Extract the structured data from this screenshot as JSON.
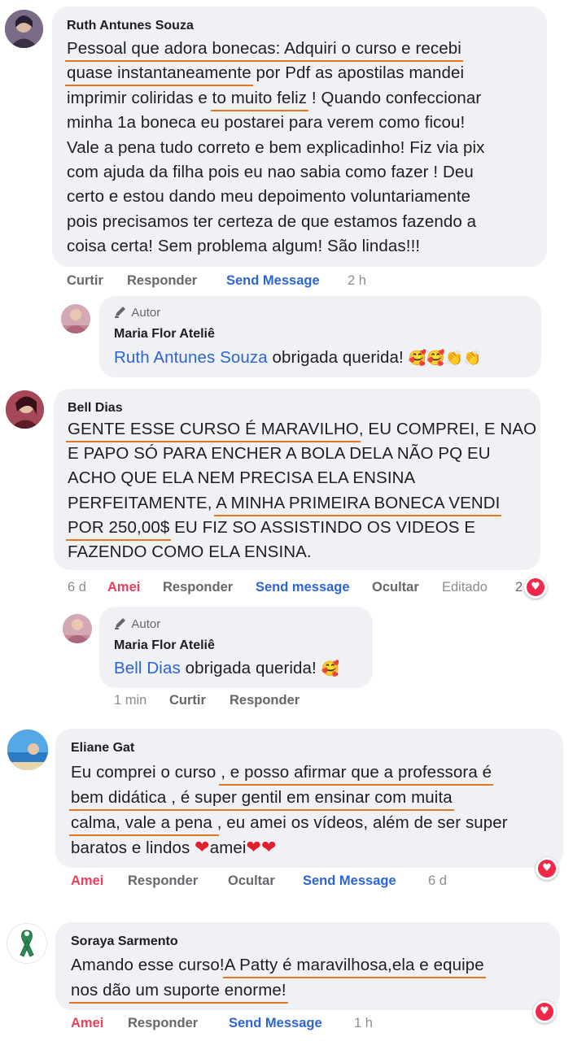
{
  "comments": [
    {
      "author": "Ruth Antunes Souza",
      "lines": [
        [
          {
            "t": "Pessoal que adora bonecas: Adquiri o curso e recebi",
            "u": true
          }
        ],
        [
          {
            "t": "quase instantaneamente",
            "u": true
          },
          {
            "t": " por Pdf as apostilas mandei"
          }
        ],
        [
          {
            "t": "imprimir coliridas e "
          },
          {
            "t": "to muito feliz",
            "u": true
          },
          {
            "t": " ! Quando confeccionar"
          }
        ],
        [
          {
            "t": "minha 1a boneca eu postarei para verem como ficou!"
          }
        ],
        [
          {
            "t": "Vale a pena tudo correto e bem explicadinho! Fiz via pix"
          }
        ],
        [
          {
            "t": "com ajuda da filha pois eu nao sabia como fazer ! Deu"
          }
        ],
        [
          {
            "t": "certo e estou dando meu depoimento voluntariamente"
          }
        ],
        [
          {
            "t": "pois precisamos ter certeza de que estamos fazendo a"
          }
        ],
        [
          {
            "t": "coisa certa! Sem problema algum! São lindas!!!"
          }
        ]
      ],
      "actions": {
        "like": "Curtir",
        "reply": "Responder",
        "send": "Send Message",
        "time": "2 h"
      },
      "reply": {
        "badge": "Autor",
        "author": "Maria Flor Ateliê",
        "mention": "Ruth Antunes Souza",
        "text": " obrigada querida! ",
        "emojis": "🥰🥰👏👏"
      }
    },
    {
      "author": "Bell Dias",
      "lines": [
        [
          {
            "t": "GENTE ESSE CURSO É MARAVILHO",
            "u": true
          },
          {
            "t": ", EU COMPREI, E NAO"
          }
        ],
        [
          {
            "t": "E PAPO SÓ PARA ENCHER A BOLA DELA NÃO PQ EU"
          }
        ],
        [
          {
            "t": "ACHO QUE ELA NEM PRECISA ELA ENSINA"
          }
        ],
        [
          {
            "t": "PERFEITAMENTE, "
          },
          {
            "t": "A MINHA PRIMEIRA BONECA VENDI",
            "u": true
          }
        ],
        [
          {
            "t": "POR 250,00$",
            "u": true
          },
          {
            "t": " EU FIZ SO ASSISTINDO OS VIDEOS E"
          }
        ],
        [
          {
            "t": "FAZENDO COMO ELA ENSINA."
          }
        ]
      ],
      "actions": {
        "time": "6 d",
        "like": "Amei",
        "reply": "Responder",
        "send": "Send message",
        "hide": "Ocultar",
        "edited": "Editado",
        "count": "2"
      },
      "reply": {
        "badge": "Autor",
        "author": "Maria Flor Ateliê",
        "mention": "Bell Dias",
        "text": " obrigada querida! ",
        "emojis": "🥰",
        "actions": {
          "time": "1 min",
          "like": "Curtir",
          "reply": "Responder"
        }
      }
    },
    {
      "author": "Eliane Gat",
      "lines": [
        [
          {
            "t": "Eu comprei o curso "
          },
          {
            "t": ", e posso afirmar que a professora é",
            "u": true
          }
        ],
        [
          {
            "t": "bem didática , é super gentil em ensinar com muita",
            "u": true
          }
        ],
        [
          {
            "t": "calma, vale a pena ",
            "u": true
          },
          {
            "t": ", eu amei os vídeos, além de ser super"
          }
        ],
        [
          {
            "t": "baratos e lindos "
          },
          {
            "t": "❤",
            "e": true
          },
          {
            "t": "amei"
          },
          {
            "t": "❤❤",
            "e": true
          }
        ]
      ],
      "actions": {
        "like": "Amei",
        "reply": "Responder",
        "hide": "Ocultar",
        "send": "Send Message",
        "time": "6 d"
      }
    },
    {
      "author": "Soraya Sarmento",
      "lines": [
        [
          {
            "t": "Amando esse curso!"
          },
          {
            "t": "A Patty é maravilhosa,ela e equipe",
            "u": true
          }
        ],
        [
          {
            "t": "nos dão um suporte enorme!",
            "u": true
          }
        ]
      ],
      "actions": {
        "like": "Amei",
        "reply": "Responder",
        "send": "Send Message",
        "time": "1 h"
      }
    }
  ],
  "icons": {
    "edit": "pencil-icon",
    "reaction": "heart-icon"
  },
  "colors": {
    "underline": "#e5751e",
    "link": "#2d64d4",
    "love": "#e8405a",
    "bubble": "#eff1f4"
  }
}
